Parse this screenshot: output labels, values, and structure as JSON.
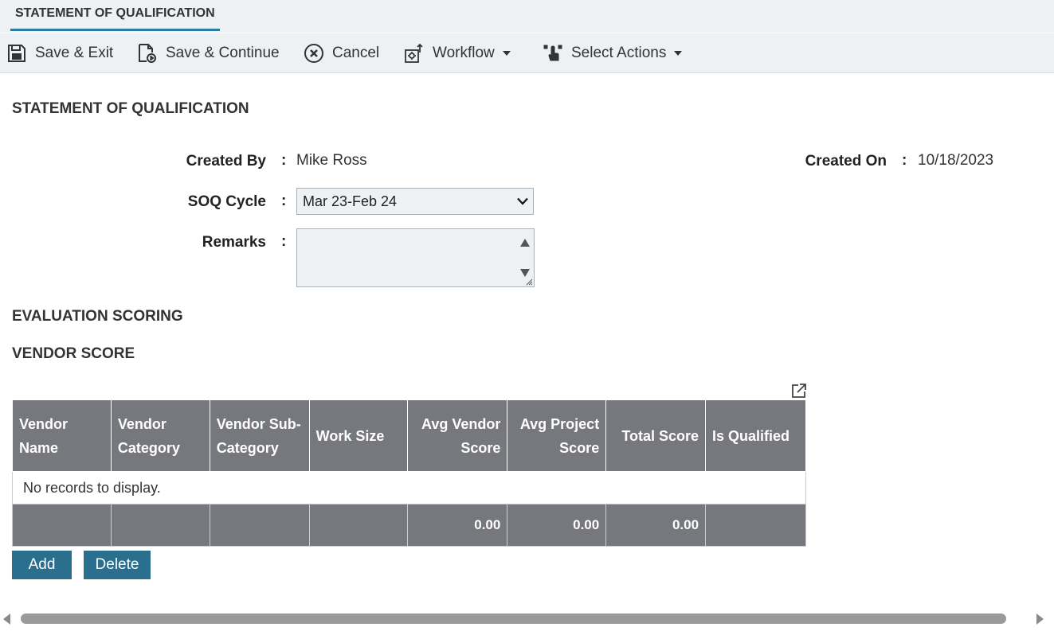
{
  "tab": {
    "label": "STATEMENT OF QUALIFICATION"
  },
  "toolbar": {
    "save_exit": "Save & Exit",
    "save_continue": "Save & Continue",
    "cancel": "Cancel",
    "workflow": "Workflow",
    "select_actions": "Select Actions"
  },
  "form": {
    "title": "STATEMENT OF QUALIFICATION",
    "created_by_label": "Created By",
    "created_by_value": "Mike Ross",
    "created_on_label": "Created On",
    "created_on_value": "10/18/2023",
    "soq_cycle_label": "SOQ Cycle",
    "soq_cycle_value": "Mar 23-Feb 24",
    "remarks_label": "Remarks",
    "remarks_value": "",
    "colon": ":"
  },
  "sections": {
    "evaluation": "EVALUATION SCORING",
    "vendor_score": "VENDOR SCORE"
  },
  "grid": {
    "columns": [
      "Vendor Name",
      "Vendor Category",
      "Vendor Sub-Category",
      "Work Size",
      "Avg Vendor Score",
      "Avg Project Score",
      "Total Score",
      "Is Qualified"
    ],
    "empty_message": "No records to display.",
    "footer": {
      "avg_vendor_score": "0.00",
      "avg_project_score": "0.00",
      "total_score": "0.00"
    }
  },
  "buttons": {
    "add": "Add",
    "delete": "Delete"
  },
  "colors": {
    "accent": "#2b7da0",
    "button": "#2b6f8e",
    "header": "#76787d",
    "toolbar_bg": "#eef1f4"
  }
}
